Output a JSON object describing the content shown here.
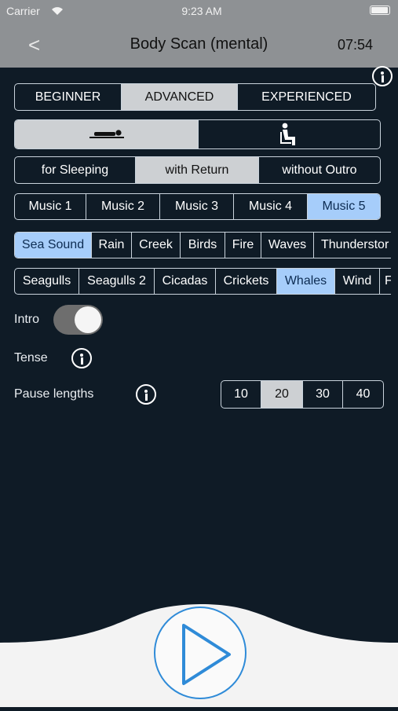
{
  "status_bar": {
    "carrier": "Carrier",
    "time": "9:23 AM"
  },
  "header": {
    "back_label": "<",
    "title": "Body Scan (mental)",
    "timer": "07:54"
  },
  "level_tabs": [
    "BEGINNER",
    "ADVANCED",
    "EXPERIENCED"
  ],
  "level_selected": "ADVANCED",
  "position": {
    "options": [
      "lying-down-icon",
      "sitting-icon"
    ],
    "selected": "lying-down-icon"
  },
  "mode_tabs": [
    "for Sleeping",
    "with Return",
    "without Outro"
  ],
  "mode_selected": "with Return",
  "music_tabs": [
    "Music 1",
    "Music 2",
    "Music 3",
    "Music 4",
    "Music 5"
  ],
  "music_selected": "Music 5",
  "sounds_row1": [
    "Sea Sound",
    "Rain",
    "Creek",
    "Birds",
    "Fire",
    "Waves",
    "Thunderstor"
  ],
  "sounds_row1_selected": "Sea Sound",
  "sounds_row2": [
    "Seagulls",
    "Seagulls 2",
    "Cicadas",
    "Crickets",
    "Whales",
    "Wind",
    "F"
  ],
  "sounds_row2_selected": "Whales",
  "settings": {
    "intro_label": "Intro",
    "intro_on": true,
    "tense_label": "Tense",
    "pause_label": "Pause lengths"
  },
  "pause_options": [
    "10",
    "20",
    "30",
    "40"
  ],
  "pause_selected": "20",
  "colors": {
    "background": "#0f1b26",
    "header": "#8e9194",
    "selected_gray": "#cdd0d3",
    "selected_blue": "#a6cdfa",
    "accent": "#2f8bd8"
  }
}
